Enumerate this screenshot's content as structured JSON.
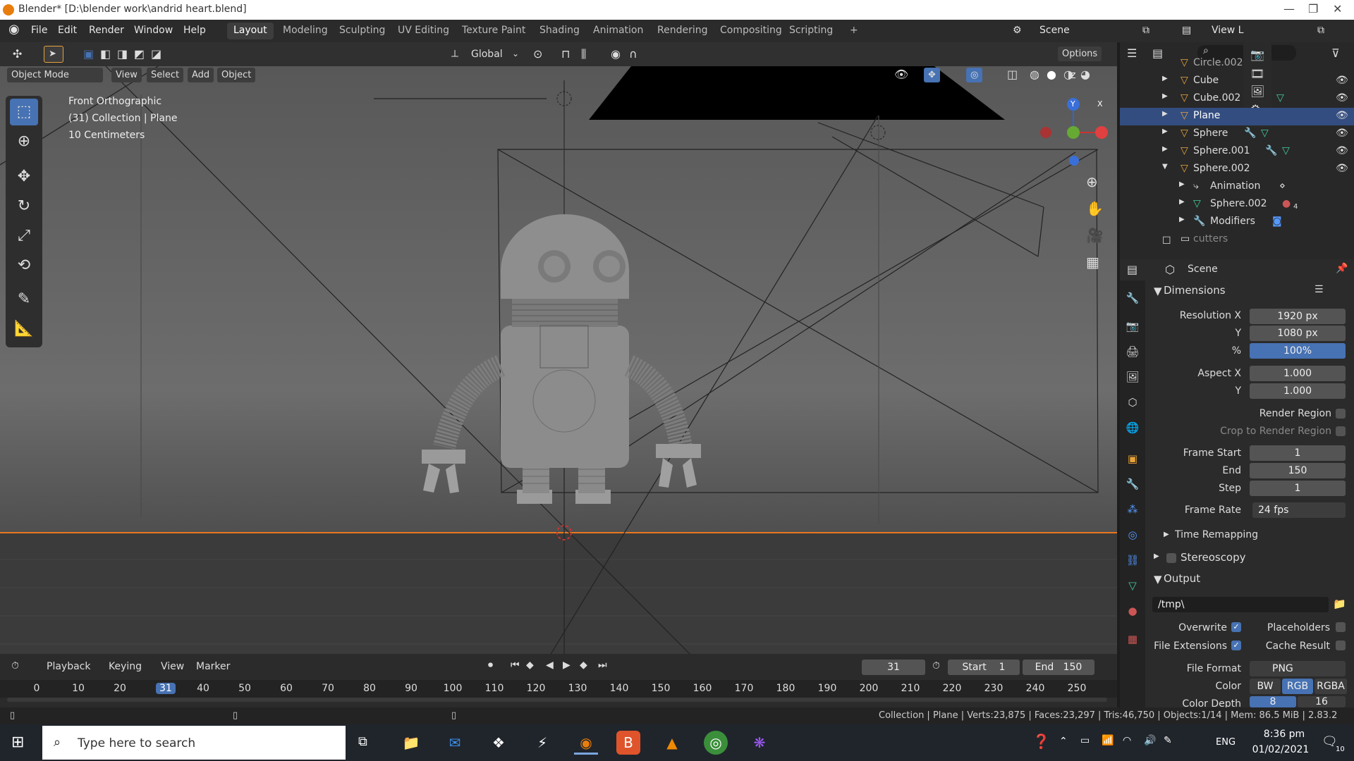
{
  "window": {
    "title": "Blender* [D:\\blender work\\andrid heart.blend]"
  },
  "menus": [
    "File",
    "Edit",
    "Render",
    "Window",
    "Help"
  ],
  "workspaces": [
    "Layout",
    "Modeling",
    "Sculpting",
    "UV Editing",
    "Texture Paint",
    "Shading",
    "Animation",
    "Rendering",
    "Compositing",
    "Scripting",
    "+"
  ],
  "scene_label": "Scene",
  "view_layer_label": "View L",
  "header": {
    "orientation": "Global",
    "options": "Options"
  },
  "viewport": {
    "mode": "Object Mode",
    "menus": [
      "View",
      "Select",
      "Add",
      "Object"
    ],
    "view_name": "Front Orthographic",
    "collection": "(31) Collection | Plane",
    "scale": "10 Centimeters",
    "axes": {
      "x": "X",
      "y": "Y",
      "z": "Z"
    }
  },
  "outliner": {
    "rows": [
      {
        "name": "Circle.002",
        "selected": false
      },
      {
        "name": "Cube",
        "selected": false
      },
      {
        "name": "Cube.002",
        "selected": false
      },
      {
        "name": "Plane",
        "selected": true
      },
      {
        "name": "Sphere",
        "selected": false
      },
      {
        "name": "Sphere.001",
        "selected": false
      },
      {
        "name": "Sphere.002",
        "selected": false
      },
      {
        "name": "Animation",
        "selected": false
      },
      {
        "name": "Sphere.002",
        "selected": false
      },
      {
        "name": "Modifiers",
        "selected": false
      },
      {
        "name": "cutters",
        "selected": false
      }
    ],
    "badge": "4"
  },
  "properties": {
    "context": "Scene",
    "dimensions": {
      "title": "Dimensions",
      "res_x_label": "Resolution X",
      "res_x": "1920 px",
      "res_y_label": "Y",
      "res_y": "1080 px",
      "pct_label": "%",
      "pct": "100%",
      "aspect_x_label": "Aspect X",
      "aspect_x": "1.000",
      "aspect_y_label": "Y",
      "aspect_y": "1.000",
      "render_region": "Render Region",
      "crop": "Crop to Render Region",
      "frame_start_label": "Frame Start",
      "frame_start": "1",
      "end_label": "End",
      "end": "150",
      "step_label": "Step",
      "step": "1",
      "frame_rate_label": "Frame Rate",
      "frame_rate": "24 fps",
      "time_remapping": "Time Remapping",
      "stereoscopy": "Stereoscopy"
    },
    "output": {
      "title": "Output",
      "path": "/tmp\\",
      "overwrite": "Overwrite",
      "placeholders": "Placeholders",
      "file_extensions": "File Extensions",
      "cache_result": "Cache Result",
      "file_format_label": "File Format",
      "file_format": "PNG",
      "color_label": "Color",
      "color_opts": [
        "BW",
        "RGB",
        "RGBA"
      ],
      "color_depth_label": "Color Depth",
      "color_depth": [
        "8",
        "16"
      ]
    }
  },
  "timeline": {
    "menus": [
      "Playback",
      "Keying",
      "View",
      "Marker"
    ],
    "current": "31",
    "start_label": "Start",
    "start": "1",
    "end_label": "End",
    "end": "150",
    "ticks": [
      "0",
      "10",
      "20",
      "31",
      "40",
      "50",
      "60",
      "70",
      "80",
      "90",
      "100",
      "110",
      "120",
      "130",
      "140",
      "150",
      "160",
      "170",
      "180",
      "190",
      "200",
      "210",
      "220",
      "230",
      "240",
      "250"
    ]
  },
  "status": {
    "text": "Collection | Plane | Verts:23,875 | Faces:23,297 | Tris:46,750 | Objects:1/14 | Mem: 86.5 MiB | 2.83.2"
  },
  "taskbar": {
    "search_placeholder": "Type here to search",
    "lang": "ENG",
    "time": "8:36 pm",
    "date": "01/02/2021",
    "notif": "10"
  }
}
